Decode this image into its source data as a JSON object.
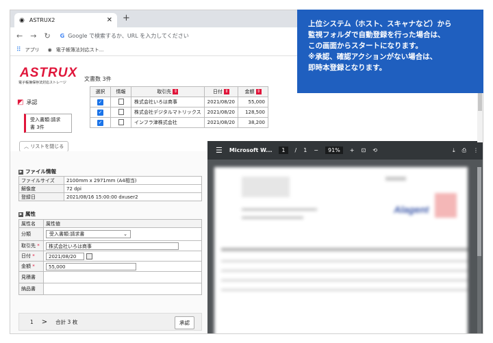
{
  "browser": {
    "tab_title": "ASTRUX2",
    "omnibox_placeholder": "Google で検索するか、URL を入力してください",
    "bookmarks": [
      "アプリ",
      "電子帳簿法対応スト..."
    ]
  },
  "app": {
    "logo": "ASTRUX",
    "logo_sub": "電子帳簿保存法対応ストレージ",
    "nav_label": "承認",
    "nav_box": [
      "受入書類:請求",
      "書 3件"
    ],
    "doc_count": "文書数 3件",
    "list_toggle": "リストを閉じる",
    "table": {
      "headers": [
        "選択",
        "情報",
        "取引先",
        "日付",
        "金額"
      ],
      "rows": [
        {
          "partner": "株式会社いろは商事",
          "date": "2021/08/20",
          "amount": "55,000"
        },
        {
          "partner": "株式会社デジタルマトリックス",
          "date": "2021/08/20",
          "amount": "128,500"
        },
        {
          "partner": "インフラ津株式会社",
          "date": "2021/08/20",
          "amount": "38,200"
        }
      ]
    },
    "file_info": {
      "title": "ファイル情報",
      "rows": [
        {
          "k": "ファイルサイズ",
          "v": "2100mm x 2971mm (A4相当)"
        },
        {
          "k": "解像度",
          "v": "72 dpi"
        },
        {
          "k": "登録日",
          "v": "2021/08/16 15:00:00 dxuser2"
        }
      ]
    },
    "attributes": {
      "title": "属性",
      "head_k": "属性名",
      "head_v": "属性値",
      "class_k": "分類",
      "class_v": "受入書類:請求書",
      "partner_k": "取引先",
      "partner_v": "株式会社いろは商事",
      "date_k": "日付",
      "date_v": "2021/08/20",
      "amount_k": "金額",
      "amount_v": "55,000",
      "estimate_k": "見積書",
      "delivery_k": "納品書",
      "required_mark": "*"
    },
    "footer": {
      "page": "1",
      "next": ">",
      "total": "合計 3 枚",
      "approve": "承認"
    }
  },
  "pdf_viewer": {
    "title": "Microsoft W...",
    "page_current": "1",
    "page_sep": "/",
    "page_total": "1",
    "zoom": "91%",
    "doc_logo": "Alagent"
  },
  "callout": {
    "lines": [
      "上位システム（ホスト、スキャナなど）から",
      "監視フォルダで自動登録を行った場合は、",
      "この画面からスタートになります。",
      "※承認、確認アクションがない場合は、",
      "即時本登録となります。"
    ]
  }
}
